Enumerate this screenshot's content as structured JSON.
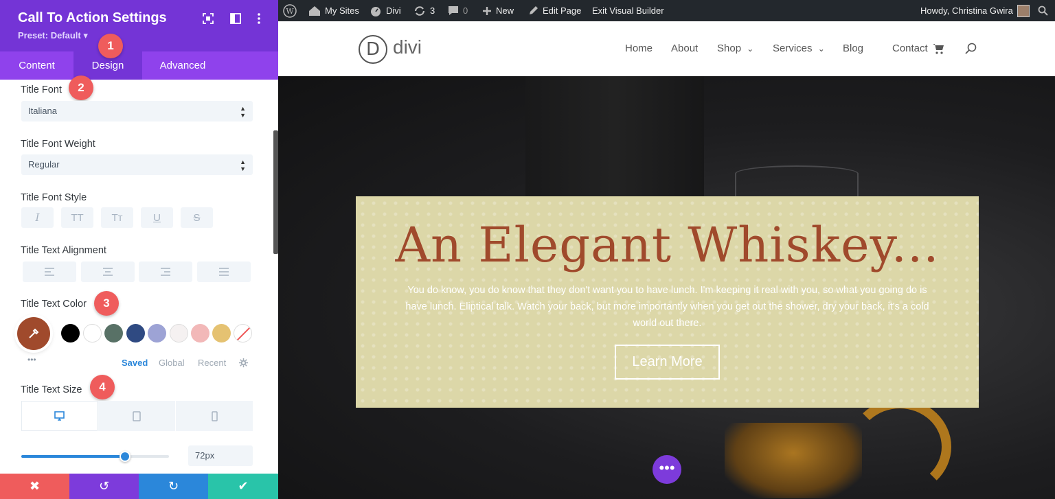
{
  "panel": {
    "title": "Call To Action Settings",
    "preset": "Preset: Default ▾",
    "tabs": [
      "Content",
      "Design",
      "Advanced"
    ],
    "active_tab": "Design",
    "title_font": {
      "label": "Title Font",
      "value": "Italiana"
    },
    "title_font_weight": {
      "label": "Title Font Weight",
      "value": "Regular"
    },
    "title_font_style": {
      "label": "Title Font Style",
      "buttons": [
        "I",
        "TT",
        "Tт",
        "U",
        "S"
      ]
    },
    "title_text_alignment": {
      "label": "Title Text Alignment"
    },
    "title_text_color": {
      "label": "Title Text Color",
      "selected": "#a04a2c",
      "swatches": [
        "#000000",
        "#ffffff",
        "#587166",
        "#2f4a82",
        "#9da3d5",
        "#f5f1f1",
        "#f2b8b8",
        "#e5c272"
      ],
      "color_tabs": [
        "Saved",
        "Global",
        "Recent"
      ],
      "more": "•••"
    },
    "title_text_size": {
      "label": "Title Text Size",
      "value": "72px",
      "slider_fraction": 0.7
    },
    "badges": [
      "1",
      "2",
      "3",
      "4"
    ],
    "footer": {
      "cancel": "✖",
      "undo": "↺",
      "redo": "↻",
      "save": "✔"
    },
    "colors": {
      "header": "#7434d6",
      "tabs": "#8f42ec",
      "badge": "#ef5c5c",
      "cancel": "#ef5c5c",
      "undo": "#7d3bdb",
      "redo": "#2b87da",
      "save": "#29c4a9"
    }
  },
  "adminbar": {
    "items": [
      "My Sites",
      "Divi",
      "3",
      "0",
      "New",
      "Edit Page",
      "Exit Visual Builder"
    ],
    "greeting": "Howdy, Christina Gwira"
  },
  "site": {
    "logo_letter": "D",
    "logo_text": "divi",
    "nav": [
      "Home",
      "About",
      "Shop",
      "Services",
      "Blog",
      "Contact"
    ],
    "chevron": "⌄"
  },
  "cta": {
    "title": "An Elegant Whiskey...",
    "body": "You do know, you do know that they don't want you to have lunch. I'm keeping it real with you, so what you going do is have lunch. Eliptical talk. Watch your back, but more importantly when you get out the shower, dry your back, it's a cold world out there.",
    "button": "Learn More",
    "fab": "•••"
  }
}
